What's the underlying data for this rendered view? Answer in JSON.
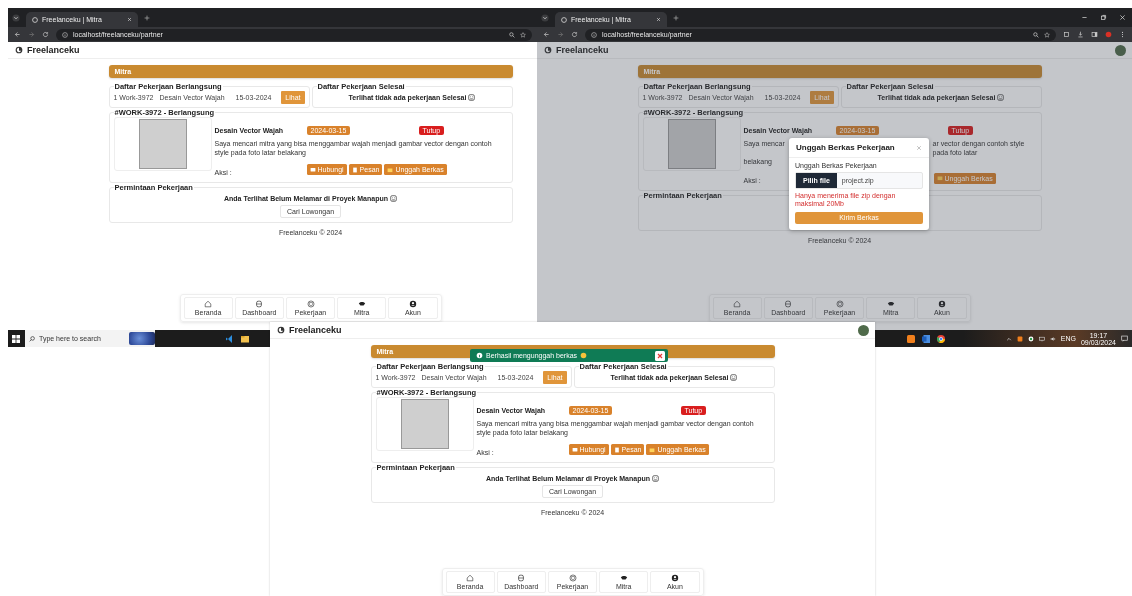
{
  "windows": [
    {
      "browser": {
        "tab_title": "Freelanceku | Mitra",
        "url": "localhost/freelanceku/partner",
        "controls": false
      },
      "page": {
        "brand": "Freelanceku",
        "banner": "Mitra",
        "ongoing": {
          "heading": "Daftar Pekerjaan Berlangsung",
          "rows": [
            {
              "work": "1 Work-3972",
              "title": "Desain Vector Wajah",
              "date": "15-03-2024",
              "button": "Lihat"
            }
          ]
        },
        "finished": {
          "heading": "Daftar Pekerjaan Selesai",
          "message": "Terlihat tidak ada pekerjaan Selesai"
        },
        "detail": {
          "heading": "#WORK-3972 - Berlangsung",
          "title": "Desain Vector Wajah",
          "date": "2024-03-15",
          "status": "Tutup",
          "description": "Saya mencari mitra yang bisa menggambar wajah menjadi gambar vector dengan contoh style pada foto latar belakang",
          "actions_label": "Aksi :",
          "actions": [
            {
              "kind": "chat",
              "label": "Hubungi"
            },
            {
              "kind": "note",
              "label": "Pesan"
            },
            {
              "kind": "folder",
              "label": "Unggah Berkas"
            }
          ]
        },
        "request": {
          "heading": "Permintaan Pekerjaan",
          "message": "Anda Terlihat Belum Melamar di Proyek Manapun",
          "button": "Cari Lowongan"
        },
        "footer": "Freelanceku © 2024",
        "nav": [
          {
            "kind": "home",
            "label": "Beranda"
          },
          {
            "kind": "dashboard",
            "label": "Dashboard"
          },
          {
            "kind": "work",
            "label": "Pekerjaan"
          },
          {
            "kind": "partner",
            "label": "Mitra"
          },
          {
            "kind": "account",
            "label": "Akun"
          }
        ]
      }
    },
    {
      "browser": {
        "tab_title": "Freelanceku | Mitra",
        "url": "localhost/freelanceku/partner",
        "controls": true
      },
      "page": {
        "brand": "Freelanceku",
        "avatar": true,
        "banner": "Mitra",
        "ongoing": {
          "heading": "Daftar Pekerjaan Berlangsung",
          "rows": [
            {
              "work": "1 Work-3972",
              "title": "Desain Vector Wajah",
              "date": "15-03-2024",
              "button": "Lihat"
            }
          ]
        },
        "finished": {
          "heading": "Daftar Pekerjaan Selesai",
          "message": "Terlihat tidak ada pekerjaan Selesai"
        },
        "detail": {
          "heading": "#WORK-3972 - Berlangsung",
          "title": "Desain Vector Wajah",
          "date": "2024-03-15",
          "status": "Tutup",
          "description_fragments": [
            "Saya mencar",
            "ar vector dengan contoh style pada foto latar",
            "belakang"
          ],
          "actions_label": "Aksi :",
          "actions": [
            {
              "kind": "folder",
              "label": "Unggah Berkas"
            }
          ]
        },
        "request": {
          "heading": "Permintaan Pekerjaan"
        },
        "footer": "Freelanceku © 2024",
        "nav": [
          {
            "kind": "home",
            "label": "Beranda"
          },
          {
            "kind": "dashboard",
            "label": "Dashboard"
          },
          {
            "kind": "work",
            "label": "Pekerjaan"
          },
          {
            "kind": "partner",
            "label": "Mitra"
          },
          {
            "kind": "account",
            "label": "Akun"
          }
        ],
        "modal": {
          "title": "Unggah Berkas Pekerjaan",
          "label": "Unggah Berkas Pekerjaan",
          "file_button": "Pilih file",
          "file_name": "project.zip",
          "hint": "Hanya menerima file zip dengan maksimal 20Mb",
          "submit": "Kirim Berkas"
        }
      }
    },
    {
      "page": {
        "brand": "Freelanceku",
        "avatar": true,
        "banner": "Mitra",
        "ongoing": {
          "heading": "Daftar Pekerjaan Berlangsung",
          "rows": [
            {
              "work": "1 Work-3972",
              "title": "Desain Vector Wajah",
              "date": "15-03-2024",
              "button": "Lihat"
            }
          ]
        },
        "finished": {
          "heading": "Daftar Pekerjaan Selesai",
          "message": "Terlihat tidak ada pekerjaan Selesai"
        },
        "detail": {
          "heading": "#WORK-3972 - Berlangsung",
          "title": "Desain Vector Wajah",
          "date": "2024-03-15",
          "status": "Tutup",
          "description": "Saya mencari mitra yang bisa menggambar wajah menjadi gambar vector dengan contoh style pada foto latar belakang",
          "actions_label": "Aksi :",
          "actions": [
            {
              "kind": "chat",
              "label": "Hubungi"
            },
            {
              "kind": "note",
              "label": "Pesan"
            },
            {
              "kind": "folder",
              "label": "Unggah Berkas"
            }
          ]
        },
        "request": {
          "heading": "Permintaan Pekerjaan",
          "message": "Anda Terlihat Belum Melamar di Proyek Manapun",
          "button": "Cari Lowongan"
        },
        "footer": "Freelanceku © 2024",
        "nav": [
          {
            "kind": "home",
            "label": "Beranda"
          },
          {
            "kind": "dashboard",
            "label": "Dashboard"
          },
          {
            "kind": "work",
            "label": "Pekerjaan"
          },
          {
            "kind": "partner",
            "label": "Mitra"
          },
          {
            "kind": "account",
            "label": "Akun"
          }
        ],
        "toast": {
          "message": "Berhasil mengunggah berkas"
        }
      }
    }
  ],
  "taskbar": {
    "search_placeholder": "Type here to search",
    "language": "ENG",
    "time": "19:17",
    "date": "09/03/2024"
  }
}
